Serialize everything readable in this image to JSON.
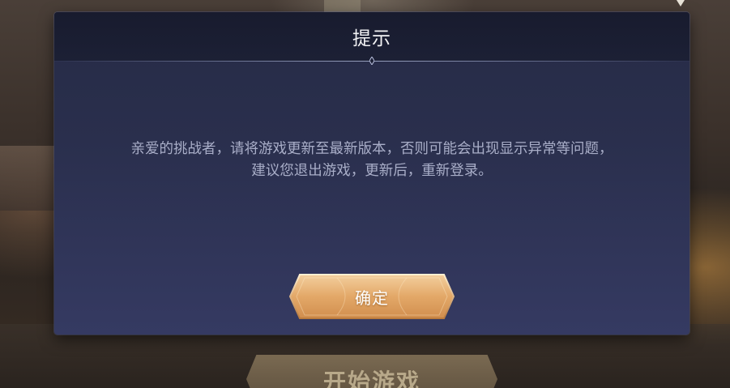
{
  "dialog": {
    "title": "提示",
    "message_lines": [
      "亲爱的挑战者，请将游戏更新至最新版本，否则可能会出现显示异常等问题，",
      "建议您退出游戏，更新后，重新登录。"
    ],
    "confirm_label": "确定"
  },
  "background": {
    "start_button_label": "开始游戏"
  },
  "colors": {
    "dialog_bg_top": "#262b46",
    "dialog_bg_bottom": "#353a62",
    "header_bg": "#181b2e",
    "message_text": "#a9aec8",
    "button_gold": "#e9b47a"
  }
}
